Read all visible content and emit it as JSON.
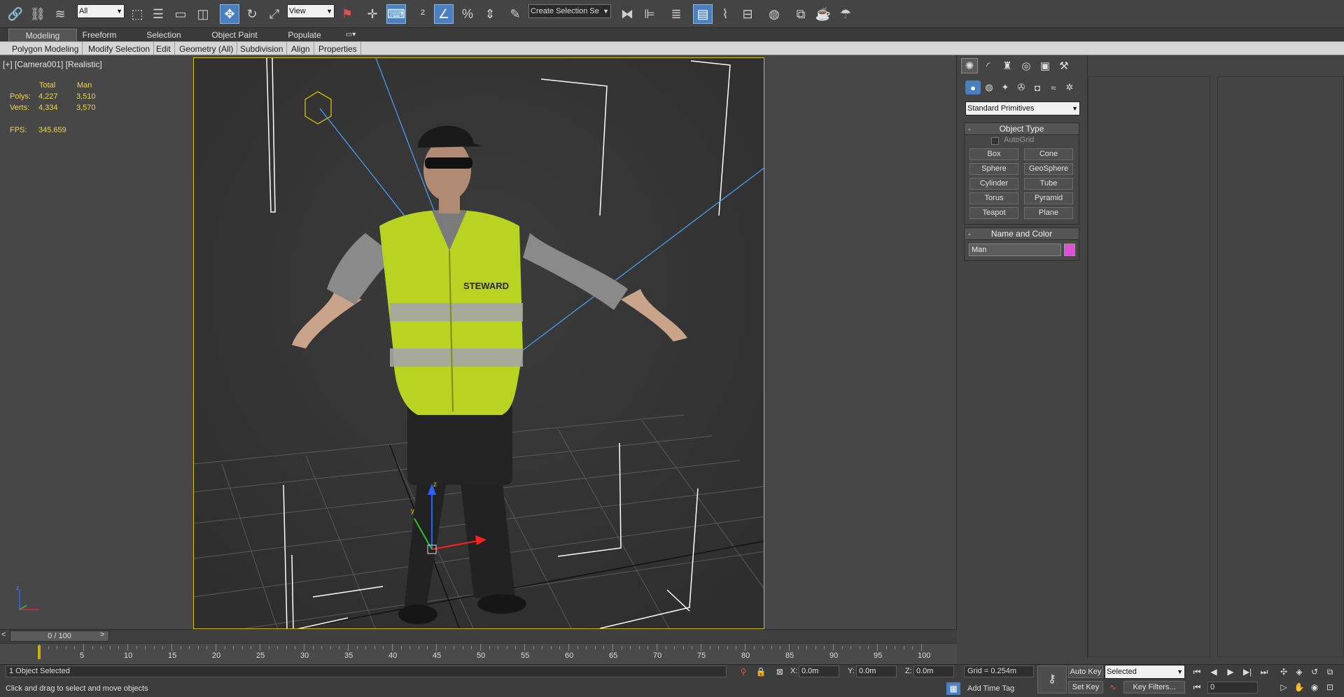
{
  "toolbar": {
    "selection_filter": "All",
    "reference_coord": "View",
    "named_selection_placeholder": "Create Selection Se"
  },
  "ribbon": {
    "tabs": [
      {
        "label": "Modeling",
        "active": true
      },
      {
        "label": "Freeform"
      },
      {
        "label": "Selection"
      },
      {
        "label": "Object Paint"
      },
      {
        "label": "Populate"
      }
    ],
    "subtabs": [
      "Polygon Modeling",
      "Modify Selection",
      "Edit",
      "Geometry (All)",
      "Subdivision",
      "Align",
      "Properties"
    ]
  },
  "viewport": {
    "label": "[+] [Camera001] [Realistic]",
    "stats": {
      "header_total": "Total",
      "header_object": "Man",
      "polys_label": "Polys:",
      "polys_total": "4,227",
      "polys_object": "3,510",
      "verts_label": "Verts:",
      "verts_total": "4,334",
      "verts_object": "3,570",
      "fps_label": "FPS:",
      "fps_value": "345.659"
    },
    "vest_text": "STEWARD"
  },
  "command_panel": {
    "category": "Standard Primitives",
    "object_type": {
      "title": "Object Type",
      "autogrid_label": "AutoGrid",
      "autogrid_checked": false,
      "buttons": [
        "Box",
        "Cone",
        "Sphere",
        "GeoSphere",
        "Cylinder",
        "Tube",
        "Torus",
        "Pyramid",
        "Teapot",
        "Plane"
      ]
    },
    "name_color": {
      "title": "Name and Color",
      "name": "Man",
      "color": "#e04fd4"
    }
  },
  "timeline": {
    "frame_display": "0 / 100",
    "ticks": [
      "5",
      "10",
      "15",
      "20",
      "25",
      "30",
      "35",
      "40",
      "45",
      "50",
      "55",
      "60",
      "65",
      "70",
      "75",
      "80",
      "85",
      "90",
      "95",
      "100"
    ]
  },
  "status": {
    "selection_info": "1 Object Selected",
    "prompt": "Click and drag to select and move objects",
    "x_label": "X:",
    "x_value": "0.0m",
    "y_label": "Y:",
    "y_value": "0.0m",
    "z_label": "Z:",
    "z_value": "0.0m",
    "grid": "Grid = 0.254m",
    "add_time_tag": "Add Time Tag",
    "auto_key": "Auto Key",
    "set_key": "Set Key",
    "key_mode": "Selected",
    "key_filters": "Key Filters...",
    "current_frame": "0"
  }
}
